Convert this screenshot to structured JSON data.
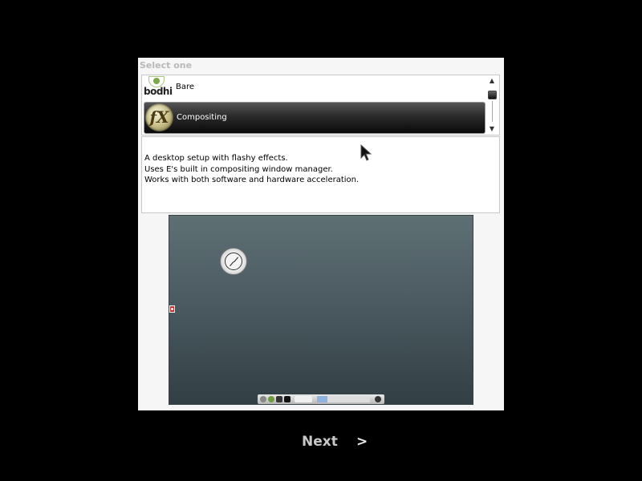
{
  "wizard": {
    "title": "Select one",
    "profiles": [
      {
        "label": "Bare",
        "icon": "bodhi-logo",
        "logo_text": "bodhi",
        "selected": false
      },
      {
        "label": "Compositing",
        "icon": "fx-logo",
        "logo_text": "fX",
        "selected": true
      }
    ],
    "description": [
      "A desktop setup with flashy effects.",
      "Uses E's built in compositing window manager.",
      "Works with both software and hardware acceleration."
    ],
    "next_label": "Next",
    "next_arrow": ">"
  },
  "colors": {
    "background": "#000000",
    "panel": "#f6f6f6",
    "selected_row": "#1a1a1a",
    "preview_desktop": "#4b5b61",
    "next_text": "#c8c8c8"
  }
}
